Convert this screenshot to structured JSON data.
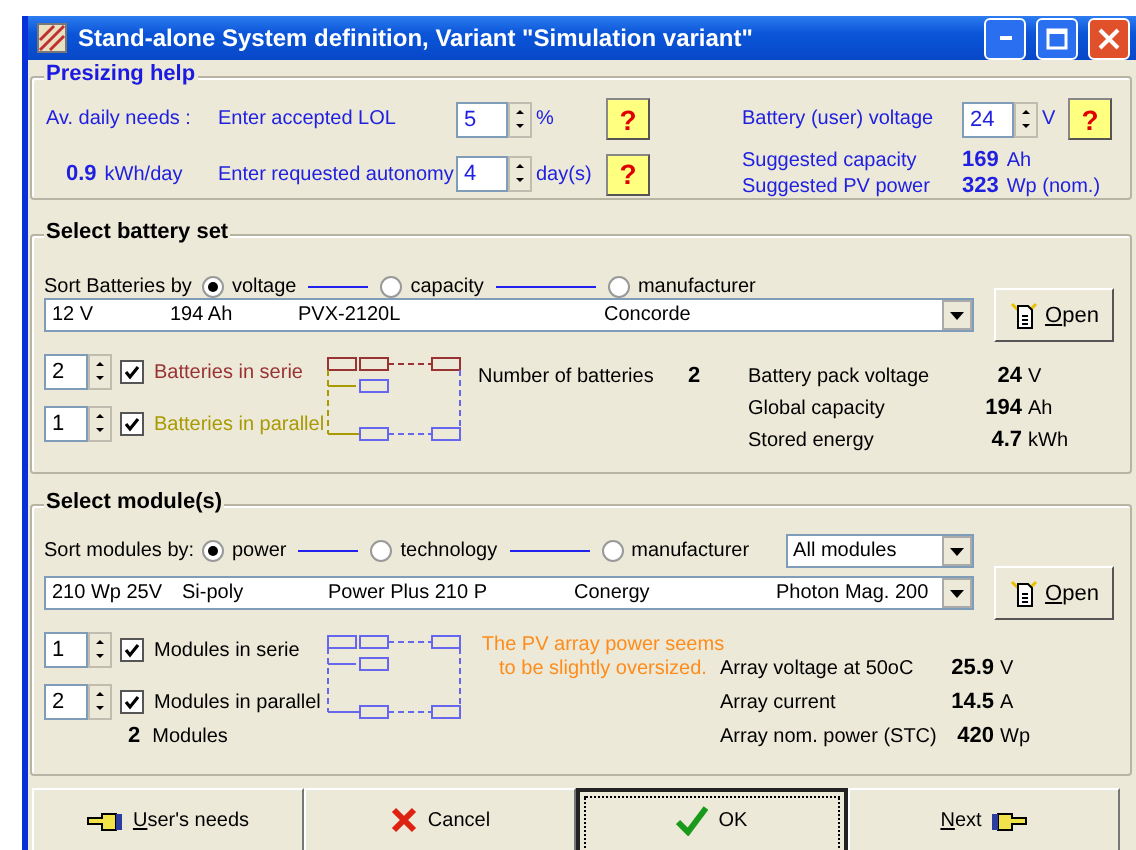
{
  "window": {
    "title": "Stand-alone System definition, Variant  \"Simulation variant\""
  },
  "presizing": {
    "title": "Presizing help",
    "daily_needs_label": "Av. daily needs :",
    "daily_needs_value": "0.9",
    "daily_needs_unit": "kWh/day",
    "lol": {
      "label": "Enter accepted LOL",
      "value": "5",
      "unit": "%",
      "help": "?"
    },
    "autonomy": {
      "label": "Enter requested autonomy",
      "value": "4",
      "unit": "day(s)",
      "help": "?"
    },
    "battery_voltage": {
      "label": "Battery (user) voltage",
      "value": "24",
      "unit": "V",
      "help": "?"
    },
    "suggestions": [
      {
        "label": "Suggested capacity",
        "value": "169",
        "unit": "Ah"
      },
      {
        "label": "Suggested PV power",
        "value": "323",
        "unit": "Wp (nom.)"
      }
    ]
  },
  "battery_set": {
    "title": "Select battery set",
    "sort_label": "Sort Batteries by",
    "sort_options": [
      {
        "label": "voltage",
        "selected": true
      },
      {
        "label": "capacity",
        "selected": false
      },
      {
        "label": "manufacturer",
        "selected": false
      }
    ],
    "selection": [
      "12 V",
      "194 Ah",
      "PVX-2120L",
      "Concorde"
    ],
    "open_button": {
      "label": "Open",
      "underline": true
    },
    "series": {
      "value": "2",
      "checked": true,
      "label": "Batteries in serie",
      "color": "#993333"
    },
    "parallel": {
      "value": "1",
      "checked": true,
      "label": "Batteries in parallel",
      "color": "#a89a00"
    },
    "count_label": "Number of batteries",
    "count_value": "2",
    "stats": [
      {
        "label": "Battery pack voltage",
        "value": "24",
        "unit": "V"
      },
      {
        "label": "Global capacity",
        "value": "194",
        "unit": "Ah"
      },
      {
        "label": "Stored energy",
        "value": "4.7",
        "unit": "kWh"
      }
    ]
  },
  "modules": {
    "title": "Select module(s)",
    "sort_label": "Sort modules by:",
    "sort_options": [
      {
        "label": "power",
        "selected": true
      },
      {
        "label": "technology",
        "selected": false
      },
      {
        "label": "manufacturer",
        "selected": false
      }
    ],
    "filter": "All modules",
    "selection": [
      "210 Wp 25V",
      "Si-poly",
      "Power Plus 210 P",
      "Conergy",
      "Photon Mag. 200"
    ],
    "open_button": {
      "label": "Open",
      "underline": true
    },
    "series": {
      "value": "1",
      "checked": true,
      "label": "Modules in serie",
      "color": "#000000"
    },
    "parallel": {
      "value": "2",
      "checked": true,
      "label": "Modules in parallel",
      "color": "#000000"
    },
    "count_value": "2",
    "count_label": "Modules",
    "warning": "The PV array power seems to be slightly oversized.",
    "stats": [
      {
        "label": "Array voltage at 50oC",
        "value": "25.9",
        "unit": "V"
      },
      {
        "label": "Array current",
        "value": "14.5",
        "unit": "A"
      },
      {
        "label": "Array nom. power (STC)",
        "value": "420",
        "unit": "Wp"
      }
    ]
  },
  "buttons": [
    {
      "label": "User's needs",
      "kind": "back",
      "underline": true,
      "focused": false
    },
    {
      "label": "Cancel",
      "kind": "cancel",
      "focused": false
    },
    {
      "label": "OK",
      "kind": "ok",
      "focused": true
    },
    {
      "label": "Next",
      "kind": "next",
      "underline": true,
      "focused": false
    }
  ]
}
